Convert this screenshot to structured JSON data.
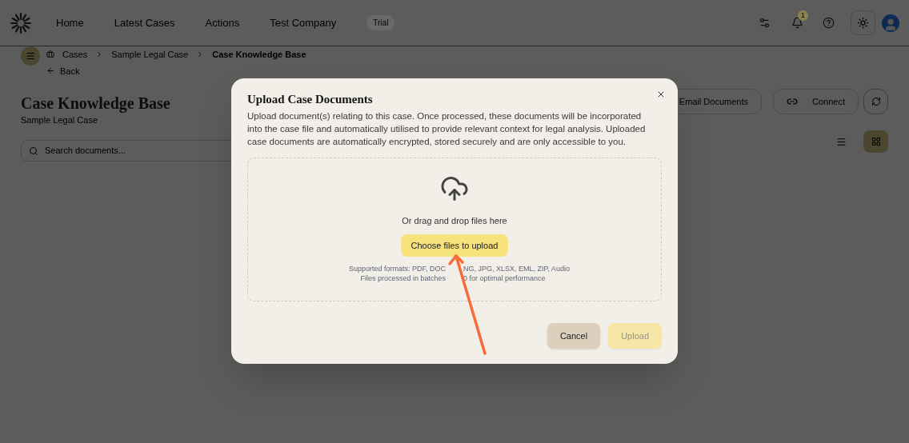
{
  "header": {
    "nav": [
      {
        "label": "Home"
      },
      {
        "label": "Latest Cases"
      },
      {
        "label": "Actions"
      },
      {
        "label": "Test Company"
      }
    ],
    "plan_badge": "Trial",
    "notification_count": "1"
  },
  "breadcrumb": [
    "Cases",
    "Sample Legal Case",
    "Case Knowledge Base"
  ],
  "back": "Back",
  "page": {
    "title": "Case Knowledge Base",
    "subtitle": "Sample Legal Case",
    "search": {
      "placeholder": "Search documents..."
    },
    "actions": [
      "Email Documents",
      "Connect"
    ],
    "views": [
      {
        "kind": "list",
        "selected": false
      },
      {
        "kind": "grid",
        "selected": true
      }
    ]
  },
  "dialog": {
    "title": "Upload Case Documents",
    "description": "Upload document(s) relating to this case. Once processed, these documents will be incorporated into the case file and automatically utilised to provide relevant context for legal analysis. Uploaded case documents are automatically encrypted, stored securely and are only accessible to you.",
    "drop_hint": "Or drag and drop files here",
    "choose_button": "Choose files to upload",
    "formats": [
      "Supported formats: PDF, DOC",
      "NG, JPG, XLSX, EML, ZIP, Audio"
    ],
    "batch_note": [
      "Files processed in batches",
      "0 for optimal performance"
    ],
    "buttons": [
      {
        "label": "Cancel",
        "kind": "secondary",
        "disabled": false
      },
      {
        "label": "Upload",
        "kind": "primary",
        "disabled": true
      }
    ]
  }
}
